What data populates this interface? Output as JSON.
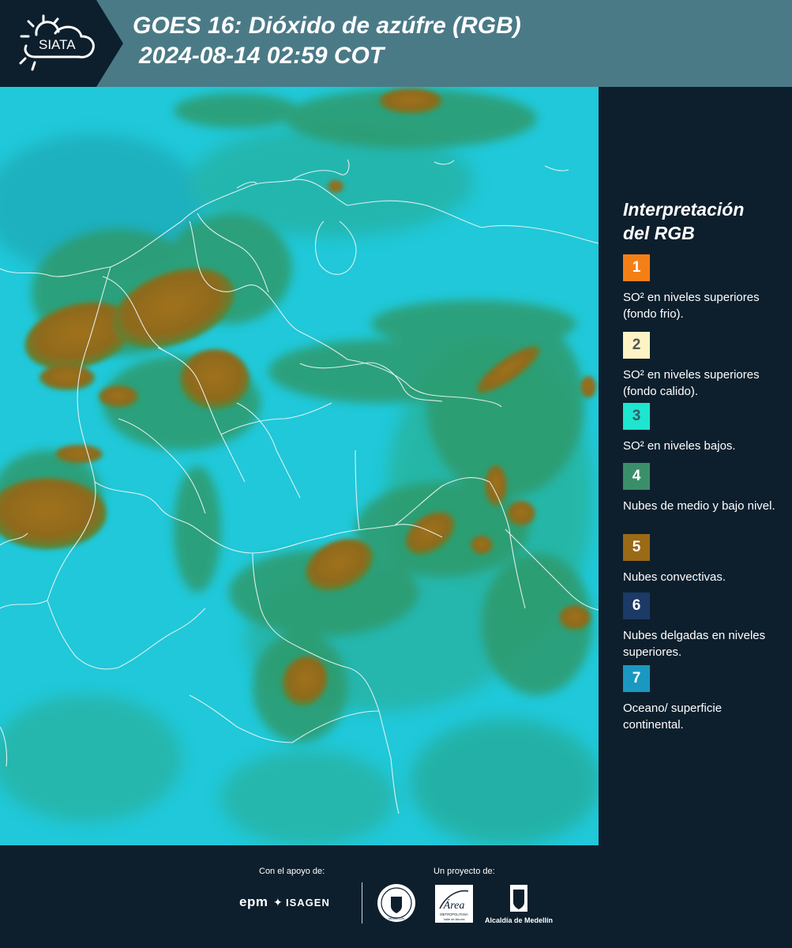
{
  "header": {
    "brand": "SIATA",
    "title_line1": "GOES 16: Dióxido de azúfre (RGB)",
    "title_line2": "2024-08-14 02:59 COT"
  },
  "legend": {
    "title_line1": "Interpretación",
    "title_line2": "del RGB",
    "items": [
      {
        "number": "1",
        "color": "#f57f17",
        "text_color": "#ffffff",
        "label": "SO² en niveles superiores (fondo frio)."
      },
      {
        "number": "2",
        "color": "#fdf3c4",
        "text_color": "#555555",
        "label": "SO² en niveles superiores (fondo calido)."
      },
      {
        "number": "3",
        "color": "#1ee5cf",
        "text_color": "#355e63",
        "label": "SO² en niveles bajos."
      },
      {
        "number": "4",
        "color": "#3a8f6a",
        "text_color": "#ffffff",
        "label": "Nubes de medio y bajo nivel."
      },
      {
        "number": "5",
        "color": "#9a6a17",
        "text_color": "#ffffff",
        "label": "Nubes convectivas."
      },
      {
        "number": "6",
        "color": "#1b3a66",
        "text_color": "#ffffff",
        "label": "Nubes delgadas en niveles superiores."
      },
      {
        "number": "7",
        "color": "#1a98c2",
        "text_color": "#ffffff",
        "label": "Oceano/ superficie continental."
      }
    ]
  },
  "footer": {
    "support_label": "Con el apoyo de:",
    "project_label": "Un proyecto de:",
    "sponsor1": "epm",
    "sponsor2": "ISAGEN",
    "partner1": "MEDELLÍN",
    "partner2_title": "Área",
    "partner2_sub1": "METROPOLITANA",
    "partner2_sub2": "Valle de Aburrá",
    "partner3": "Alcaldía de Medellín"
  },
  "colors": {
    "header_bg": "#4b7a87",
    "logo_bg": "#0d1f2d",
    "panel_bg": "#0d1f2d",
    "map_base": "#1fc6d8",
    "cloud_mid": "#2f9d74",
    "cloud_convective": "#9a6a17"
  }
}
